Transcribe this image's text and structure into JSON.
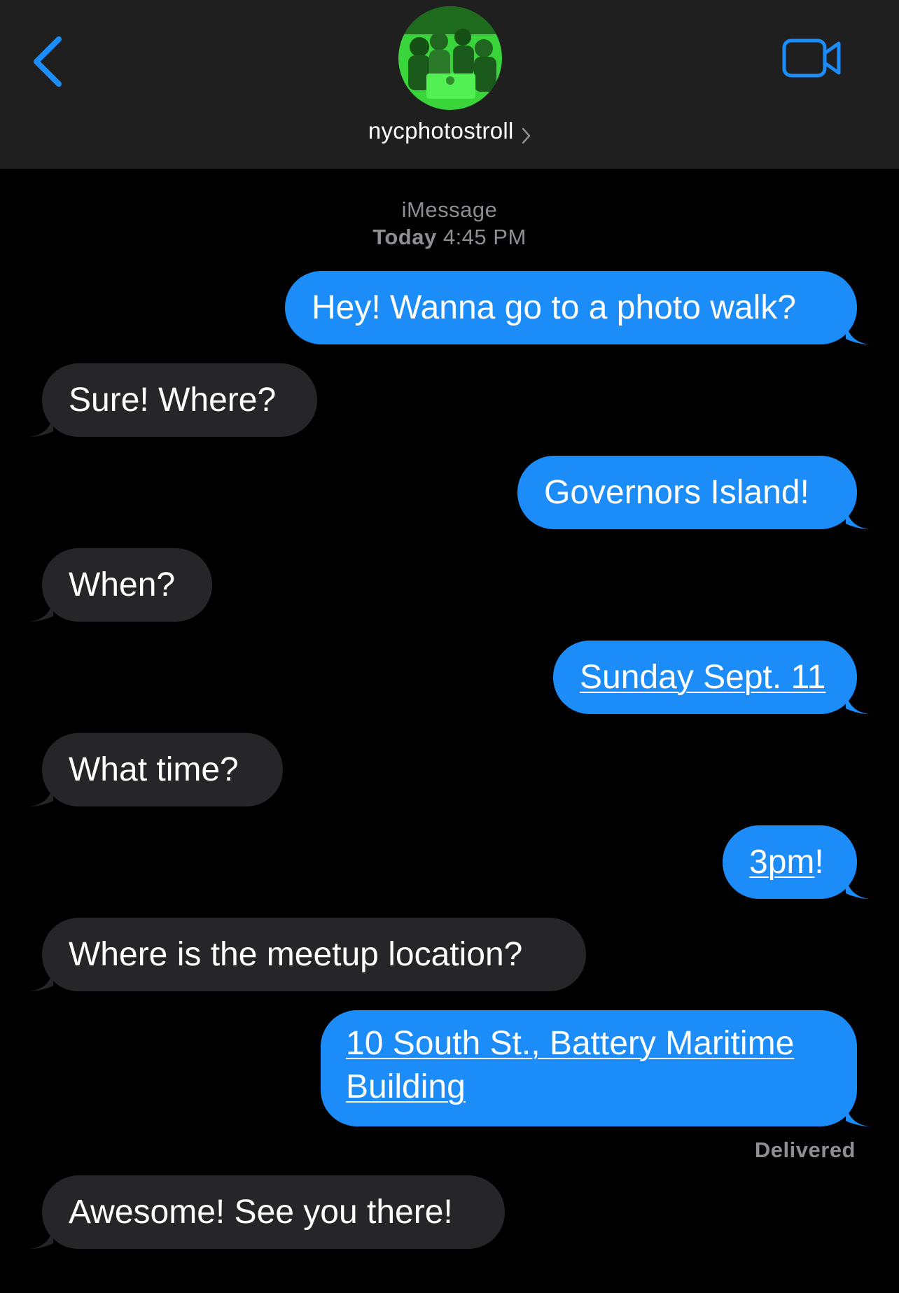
{
  "header": {
    "contact_name": "nycphotostroll",
    "back_icon": "chevron-left-icon",
    "video_icon": "video-camera-icon",
    "accent_color": "#1c8cf9",
    "background_color": "#1f1f1f"
  },
  "thread": {
    "service_label": "iMessage",
    "timestamp_day": "Today",
    "timestamp_time": "4:45 PM",
    "delivered_label": "Delivered"
  },
  "messages": [
    {
      "direction": "sent",
      "text": "Hey! Wanna go to a photo walk?"
    },
    {
      "direction": "received",
      "text": "Sure! Where?"
    },
    {
      "direction": "sent",
      "text": "Governors Island!"
    },
    {
      "direction": "received",
      "text": "When?"
    },
    {
      "direction": "sent",
      "text": "Sunday Sept. 11",
      "link": true
    },
    {
      "direction": "received",
      "text": "What time?"
    },
    {
      "direction": "sent",
      "text_link": "3pm",
      "text_rest": "!"
    },
    {
      "direction": "received",
      "text": "Where is the meetup location?"
    },
    {
      "direction": "sent",
      "text_line1": "10 South St., Battery Maritime",
      "text_line2": "Building",
      "link": true
    },
    {
      "direction": "received",
      "text": "Awesome! See you there!"
    }
  ],
  "colors": {
    "sent_bubble": "#1c8cf9",
    "received_bubble": "#262628",
    "meta_text": "#8e8e93",
    "avatar_tint": "#39e63a"
  }
}
